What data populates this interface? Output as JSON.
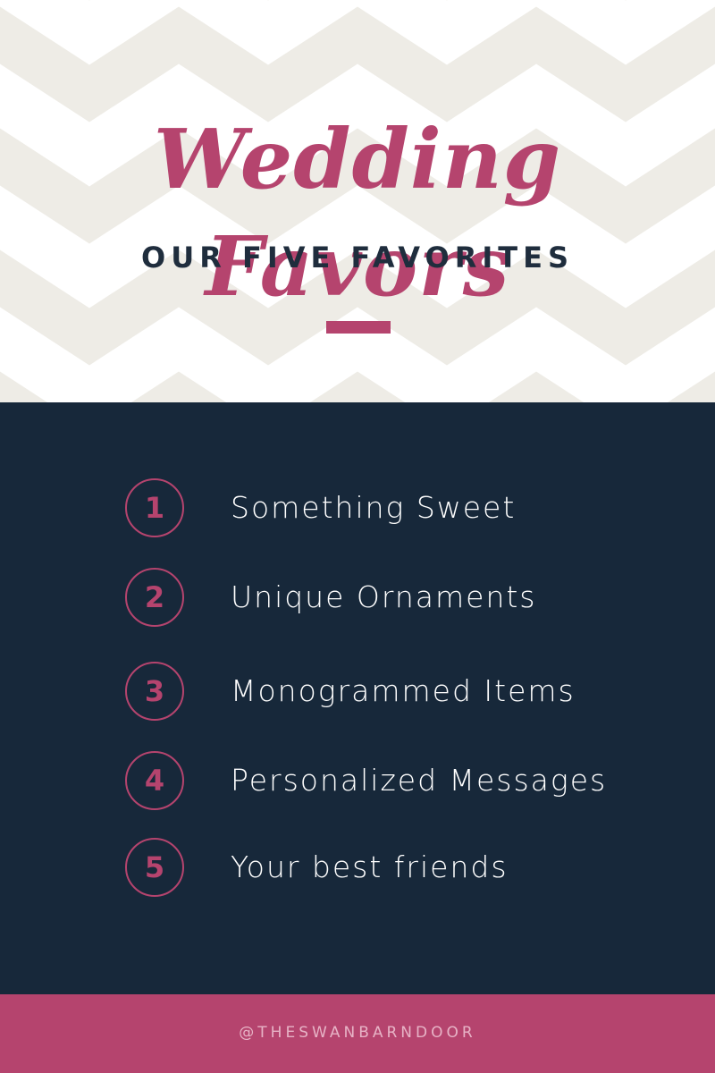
{
  "header": {
    "title": "Wedding Favors",
    "subtitle": "OUR FIVE FAVORITES"
  },
  "list": {
    "items": [
      {
        "number": "1",
        "label": "Something Sweet"
      },
      {
        "number": "2",
        "label": "Unique Ornaments"
      },
      {
        "number": "3",
        "label": "Monogrammed Items"
      },
      {
        "number": "4",
        "label": "Personalized Messages"
      },
      {
        "number": "5",
        "label": "Your best friends"
      }
    ]
  },
  "footer": {
    "handle": "@THESWANBARNDOOR"
  },
  "colors": {
    "accent": "#b5446e",
    "navy": "#17283a",
    "chevron": "#eeece6",
    "background": "#ffffff",
    "text_dark": "#1f2d3d",
    "text_light": "#ffffff",
    "footer_text": "#e7b3c6"
  }
}
